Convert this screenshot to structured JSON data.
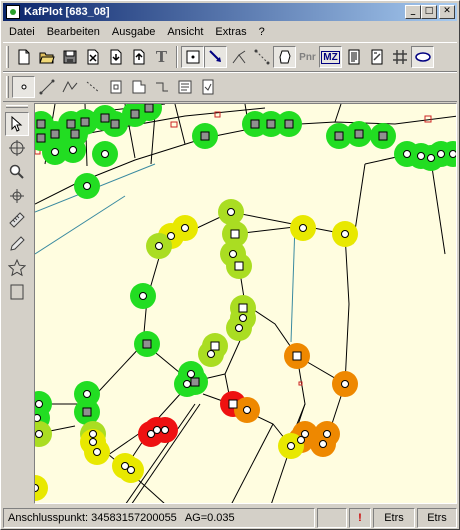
{
  "window": {
    "title": "KafPlot [683_08]"
  },
  "menu": {
    "items": [
      "Datei",
      "Bearbeiten",
      "Ausgabe",
      "Ansicht",
      "Extras",
      "?"
    ]
  },
  "toolbar1": {
    "pnr_label": "Pnr",
    "mz_label": "MZ",
    "text_tool_glyph": "T"
  },
  "status": {
    "anschluss": "Anschlusspunkt: 34583157200055",
    "ag": "AG=0.035",
    "warning": "!",
    "crs1": "Etrs",
    "crs2": "Etrs"
  },
  "colors": {
    "canvas_bg": "#fffde0",
    "green": "#22dd22",
    "yellow_green": "#aadd22",
    "yellow": "#e8e800",
    "orange": "#ee8800",
    "red": "#ee1111",
    "line": "#000000",
    "water": "#3a8aa0",
    "parcel_red": "#cc2222"
  }
}
